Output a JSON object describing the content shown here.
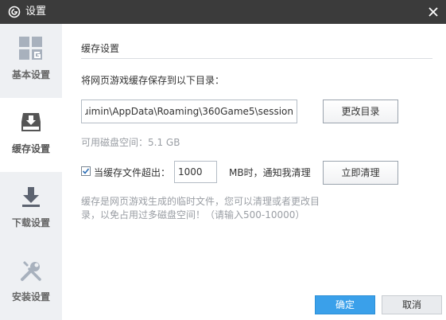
{
  "window": {
    "title": "设置"
  },
  "icons": {
    "app_logo": "circle-g-logo-icon",
    "close": "close-icon",
    "basic": "grid-g-icon",
    "cache": "cache-download-tray-icon",
    "download": "download-arrow-icon",
    "install": "wrench-screwdriver-icon",
    "checkbox": "checkmark-icon"
  },
  "sidebar": {
    "items": [
      {
        "label": "基本设置",
        "active": false
      },
      {
        "label": "缓存设置",
        "active": true
      },
      {
        "label": "下载设置",
        "active": false
      },
      {
        "label": "安装设置",
        "active": false
      }
    ]
  },
  "cache": {
    "section_title": "缓存设置",
    "save_dir_label": "将网页游戏缓存保存到以下目录：",
    "path_value": "uimin\\AppData\\Roaming\\360Game5\\session\\",
    "change_dir_button": "更改目录",
    "available_space": "可用磁盘空间：5.1 GB",
    "limit_checked": true,
    "limit_label": "当缓存文件超出：",
    "limit_value": "1000",
    "limit_suffix": "MB时，通知我清理",
    "clear_button": "立即清理",
    "hint": "缓存是网页游戏生成的临时文件，您可以清理或者更改目录，以免占用过多磁盘空间！（请输入500-10000）"
  },
  "footer": {
    "ok": "确定",
    "cancel": "取消"
  },
  "colors": {
    "titlebar": "#3b3b3b",
    "sidebar": "#eef0f3",
    "accent": "#3aa0ea"
  }
}
